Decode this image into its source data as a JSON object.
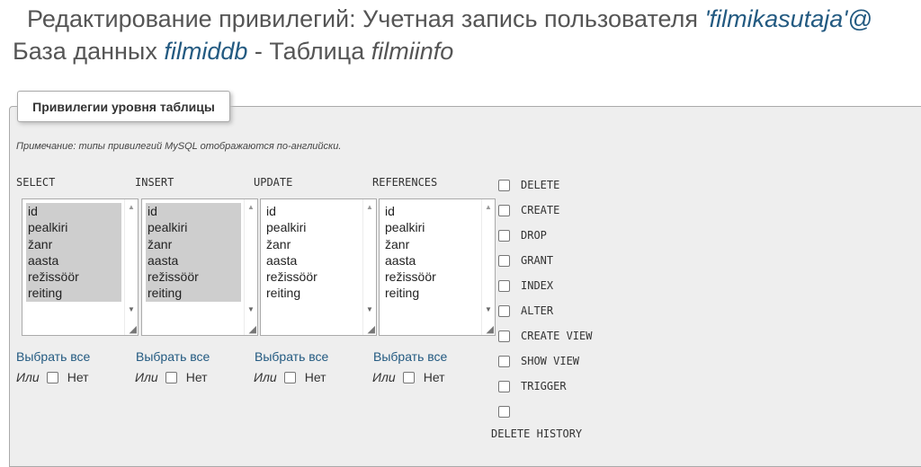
{
  "header": {
    "line1_prefix": "Редактирование привилегий: Учетная запись пользователя ",
    "user": "'filmikasutaja'@",
    "line2_prefix": "База данных ",
    "database": "filmiddb",
    "line2_mid": " - Таблица ",
    "table": "filmiinfo"
  },
  "panel": {
    "legend": "Привилегии уровня таблицы",
    "note": "Примечание: типы привилегий MySQL отображаются по-английски."
  },
  "columns": [
    {
      "name": "SELECT",
      "options": [
        "id",
        "pealkiri",
        "žanr",
        "aasta",
        "režissöör",
        "reiting"
      ],
      "select_all": "Выбрать все",
      "or": "Или",
      "none": "Нет"
    },
    {
      "name": "INSERT",
      "options": [
        "id",
        "pealkiri",
        "žanr",
        "aasta",
        "režissöör",
        "reiting"
      ],
      "select_all": "Выбрать все",
      "or": "Или",
      "none": "Нет"
    },
    {
      "name": "UPDATE",
      "options": [
        "id",
        "pealkiri",
        "žanr",
        "aasta",
        "režissöör",
        "reiting"
      ],
      "select_all": "Выбрать все",
      "or": "Или",
      "none": "Нет"
    },
    {
      "name": "REFERENCES",
      "options": [
        "id",
        "pealkiri",
        "žanr",
        "aasta",
        "režissöör",
        "reiting"
      ],
      "select_all": "Выбрать все",
      "or": "Или",
      "none": "Нет"
    }
  ],
  "privileges": [
    "DELETE",
    "CREATE",
    "DROP",
    "GRANT",
    "INDEX",
    "ALTER",
    "CREATE VIEW",
    "SHOW VIEW",
    "TRIGGER",
    "DELETE HISTORY"
  ]
}
